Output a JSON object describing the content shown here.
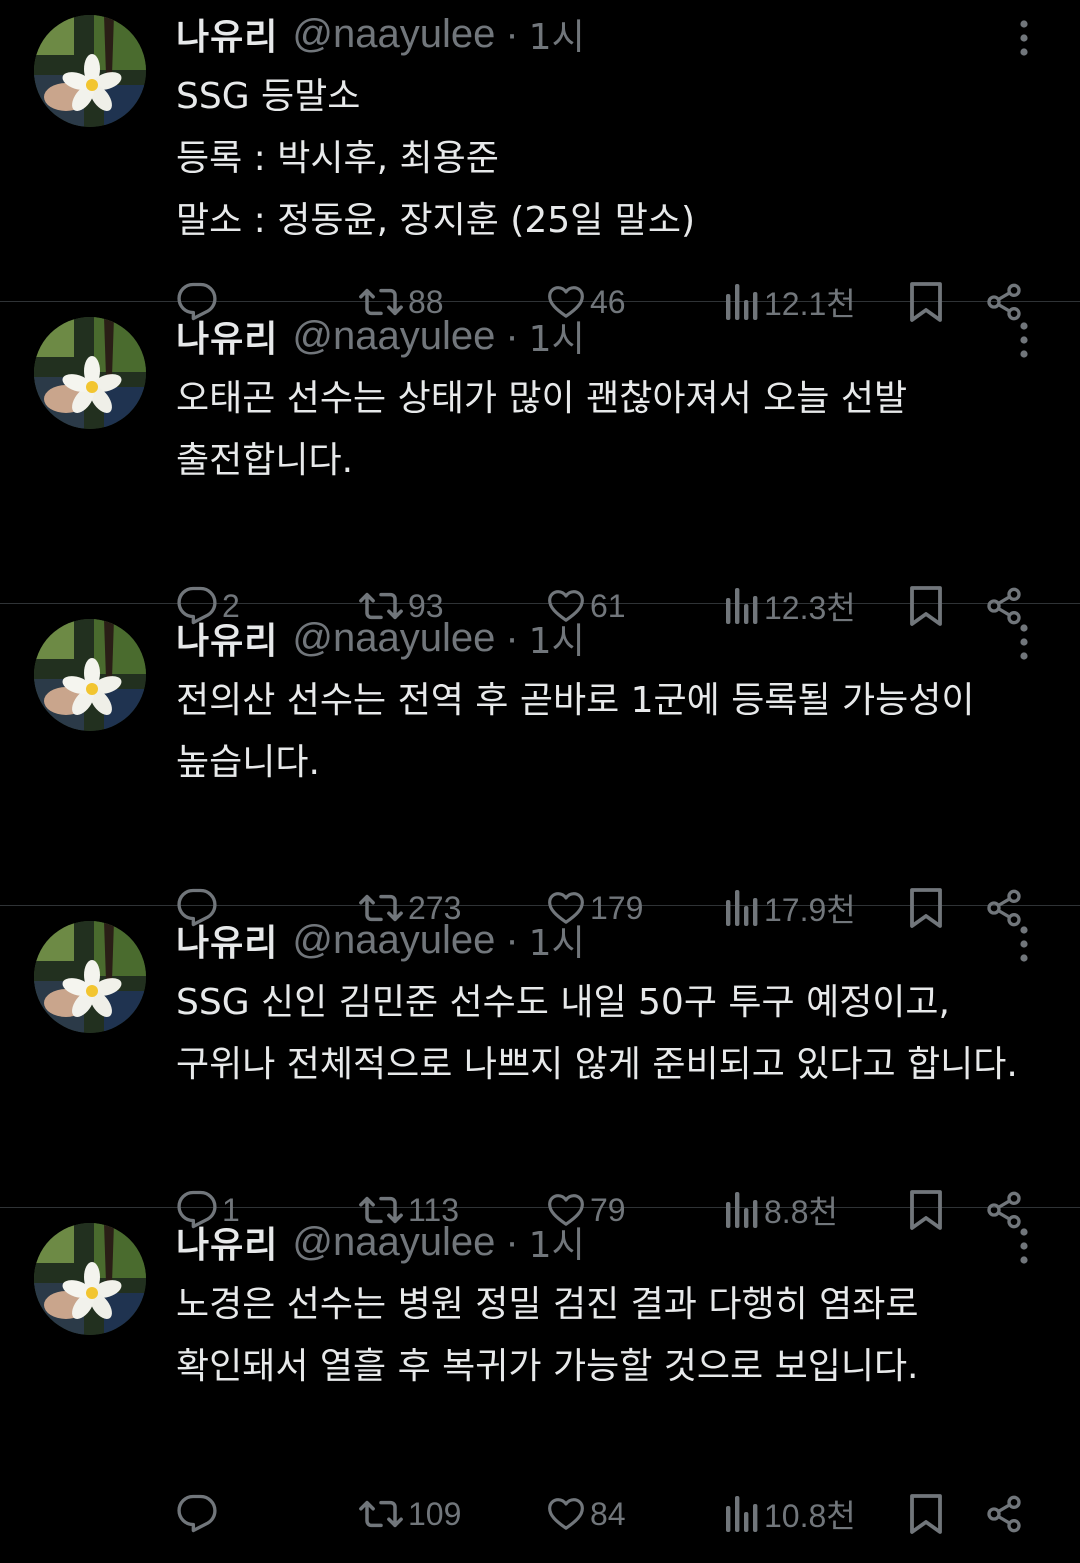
{
  "colors": {
    "background": "#000000",
    "text": "#e7e9ea",
    "muted": "#71767b",
    "divider": "#2f3336"
  },
  "icons": [
    "more-vertical-icon",
    "reply-icon",
    "retweet-icon",
    "like-icon",
    "views-icon",
    "bookmark-icon",
    "share-icon"
  ],
  "tweets": [
    {
      "name": "나유리",
      "handle": "@naayulee",
      "dot": "·",
      "time": "1시",
      "lines": [
        "SSG 등말소",
        "등록 : 박시후, 최용준",
        "말소 : 정동윤, 장지훈 (25일 말소)"
      ],
      "replies": "",
      "retweets": "88",
      "likes": "46",
      "views": "12.1천"
    },
    {
      "name": "나유리",
      "handle": "@naayulee",
      "dot": "·",
      "time": "1시",
      "lines": [
        "오태곤 선수는 상태가 많이 괜찮아져서 오늘 선발",
        "출전합니다."
      ],
      "replies": "2",
      "retweets": "93",
      "likes": "61",
      "views": "12.3천"
    },
    {
      "name": "나유리",
      "handle": "@naayulee",
      "dot": "·",
      "time": "1시",
      "lines": [
        "전의산 선수는 전역 후 곧바로 1군에 등록될 가능성이",
        "높습니다."
      ],
      "replies": "",
      "retweets": "273",
      "likes": "179",
      "views": "17.9천"
    },
    {
      "name": "나유리",
      "handle": "@naayulee",
      "dot": "·",
      "time": "1시",
      "lines": [
        "SSG 신인 김민준 선수도 내일 50구 투구 예정이고,",
        "구위나 전체적으로 나쁘지 않게 준비되고 있다고 합니다."
      ],
      "replies": "1",
      "retweets": "113",
      "likes": "79",
      "views": "8.8천"
    },
    {
      "name": "나유리",
      "handle": "@naayulee",
      "dot": "·",
      "time": "1시",
      "lines": [
        "노경은 선수는 병원 정밀 검진 결과 다행히 염좌로",
        "확인돼서 열흘 후 복귀가 가능할 것으로 보입니다."
      ],
      "replies": "",
      "retweets": "109",
      "likes": "84",
      "views": "10.8천"
    }
  ]
}
